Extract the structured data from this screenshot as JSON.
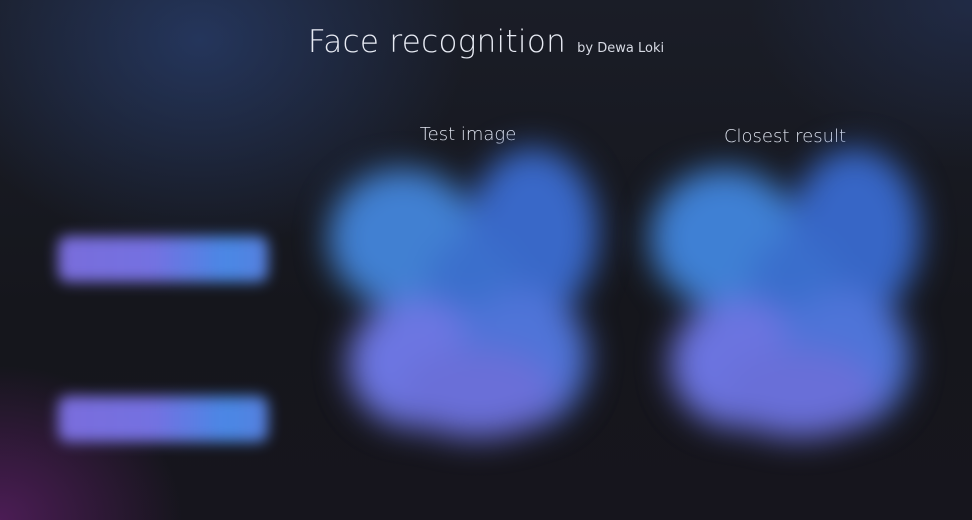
{
  "header": {
    "title": "Face recognition",
    "byline": "by Dewa Loki"
  },
  "panels": {
    "test": {
      "title": "Test image"
    },
    "result": {
      "title": "Closest result"
    }
  },
  "buttons": [
    {
      "label": ""
    },
    {
      "label": ""
    }
  ],
  "colors": {
    "background": "#15161c",
    "button_start": "#7f72e6",
    "button_end": "#4c8ef0",
    "image_blue": "#3f7fd6",
    "image_violet": "#6d74e0"
  }
}
